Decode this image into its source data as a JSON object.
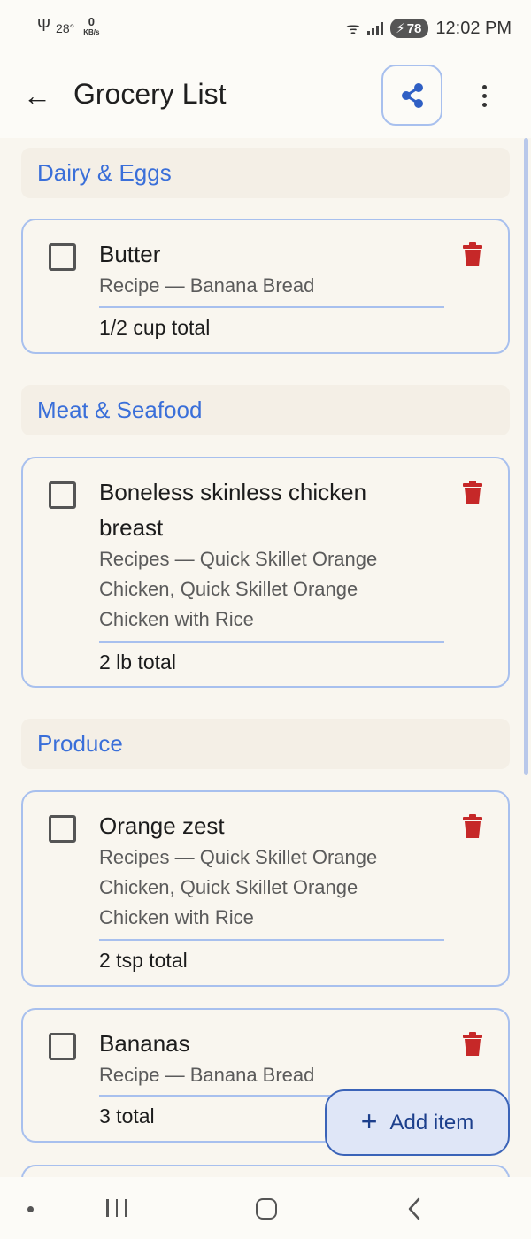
{
  "status_bar": {
    "usb_glyph": "Ψ",
    "temperature": "28°",
    "net_speed_value": "0",
    "net_speed_unit": "KB/s",
    "wifi_glyph": "ᯤ",
    "battery_level": "78",
    "time": "12:02 PM"
  },
  "app_bar": {
    "back_glyph": "←",
    "title": "Grocery List"
  },
  "sections": [
    {
      "header": "Dairy & Eggs",
      "items": [
        {
          "name": "Butter",
          "recipe": "Recipe — Banana Bread",
          "quantity": "1/2 cup total",
          "checked": false
        }
      ]
    },
    {
      "header": "Meat & Seafood",
      "items": [
        {
          "name": "Boneless skinless chicken breast",
          "recipe": "Recipes — Quick Skillet Orange Chicken, Quick Skillet Orange Chicken with Rice",
          "quantity": "2 lb total",
          "checked": false
        }
      ]
    },
    {
      "header": "Produce",
      "items": [
        {
          "name": "Orange zest",
          "recipe": "Recipes — Quick Skillet Orange Chicken, Quick Skillet Orange Chicken with Rice",
          "quantity": "2 tsp total",
          "checked": false
        },
        {
          "name": "Bananas",
          "recipe": "Recipe — Banana Bread",
          "quantity": "3 total",
          "checked": false
        }
      ]
    }
  ],
  "fab": {
    "plus_glyph": "+",
    "label": "Add item"
  },
  "colors": {
    "accent": "#3a6fd9",
    "card_border": "#a8c0ee",
    "delete": "#c62828",
    "background": "#f9f6ef"
  },
  "icons": {
    "back": "arrow-left-icon",
    "share": "share-icon",
    "more": "more-vertical-icon",
    "delete": "trash-icon",
    "add": "plus-icon"
  }
}
